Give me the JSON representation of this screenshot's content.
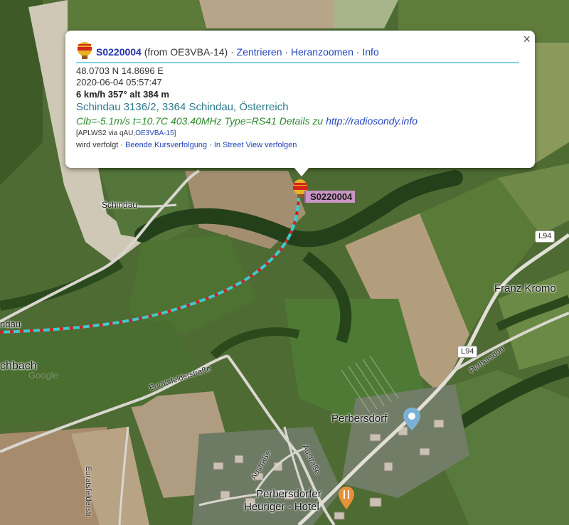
{
  "popup": {
    "close_symbol": "×",
    "callsign": "S0220004",
    "from_text": "(from OE3VBA-14)",
    "actions": [
      "Zentrieren",
      "Heranzoomen",
      "Info"
    ],
    "separator": " · ",
    "coordinates": "48.0703 N 14.8696 E",
    "timestamp": "2020-06-04 05:57:47",
    "speed_line": "6 km/h 357° alt 384 m",
    "address": "Schindau 3136/2, 3364 Schindau, Österreich",
    "comment": "Clb=-5.1m/s t=10.7C 403.40MHz Type=RS41 Details zu",
    "comment_link": "http://radiosondy.info",
    "path_prefix": "[APLWS2 via qAU,",
    "path_link": "OE3VBA-15",
    "path_suffix": "]",
    "follow_status": "wird verfolgt",
    "follow_actions": [
      "Beende Kursverfolgung",
      "In Street View verfolgen"
    ]
  },
  "marker": {
    "label": "S0220004",
    "icon": "balloon-icon"
  },
  "map_labels": {
    "schindau": "Schindau",
    "ndau": "ndau",
    "chbach": "chbach",
    "franz": "Franz Kromo",
    "perbersdorf": "Perbersdorf",
    "heuriger_line1": "Perbersdorfer",
    "heuriger_line2": "Heuriger - Hotel",
    "euratsfelder1": "Euratsfelderstraße",
    "euratsfelder2": "Euratsfelderstr",
    "austr1": "Austraße",
    "austr2": "Austraße",
    "perbersdorf_road": "Perbersdorf",
    "shield1": "L94",
    "shield2": "L94",
    "watermark": "Google"
  },
  "colors": {
    "track_primary": "#3fcbcf",
    "track_secondary": "#cc2222",
    "popup_rule": "#7dd3e3",
    "marker_label_bg": "#c995c4"
  }
}
